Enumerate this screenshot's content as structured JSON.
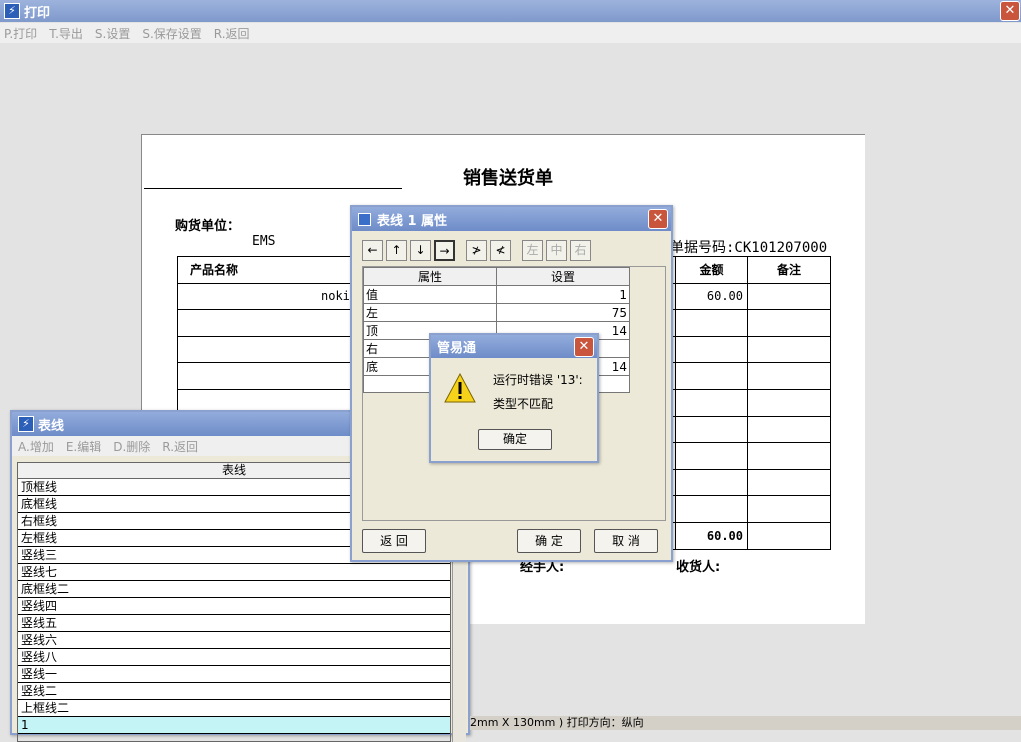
{
  "window": {
    "title": "打印"
  },
  "menu": [
    "P.打印",
    "T.导出",
    "S.设置",
    "S.保存设置",
    "R.返回"
  ],
  "document": {
    "title": "销售送货单",
    "buyer_label": "购货单位：",
    "buyer_value": "EMS",
    "doc_no": "单据号码:CK101207000",
    "headers": {
      "product": "产品名称",
      "amount": "金额",
      "remark": "备注"
    },
    "row1_product_partial": "noki",
    "row1_amount": "60.00",
    "total_amount": "60.00",
    "handler_label": "经手人:",
    "receiver_label": "收货人:"
  },
  "line_panel": {
    "title": "表线",
    "menu": [
      "A.增加",
      "E.编辑",
      "D.删除",
      "R.返回"
    ],
    "column_header": "表线",
    "items": [
      "顶框线",
      "底框线",
      "右框线",
      "左框线",
      "竖线三",
      "竖线七",
      "底框线二",
      "竖线四",
      "竖线五",
      "竖线六",
      "竖线八",
      "竖线一",
      "竖线二",
      "上框线二",
      "1"
    ]
  },
  "property_dialog": {
    "title": "表线 1 属性",
    "tools": [
      "←",
      "↑",
      "↓",
      "→",
      "≯",
      "≮",
      "左",
      "中",
      "右"
    ],
    "headers": {
      "attr": "属性",
      "setting": "设置"
    },
    "rows": [
      {
        "attr": "值",
        "value": "1"
      },
      {
        "attr": "左",
        "value": "75"
      },
      {
        "attr": "顶",
        "value": "14"
      },
      {
        "attr": "右",
        "value": ""
      },
      {
        "attr": "底",
        "value": "14"
      }
    ],
    "back_label": "返 回",
    "ok_label": "确 定",
    "cancel_label": "取 消"
  },
  "alert": {
    "title": "管易通",
    "line1": "运行时错误 '13':",
    "line2": "类型不匹配",
    "ok_label": "确定"
  },
  "status": {
    "text": "2mm X 130mm )   打印方向：纵向"
  }
}
